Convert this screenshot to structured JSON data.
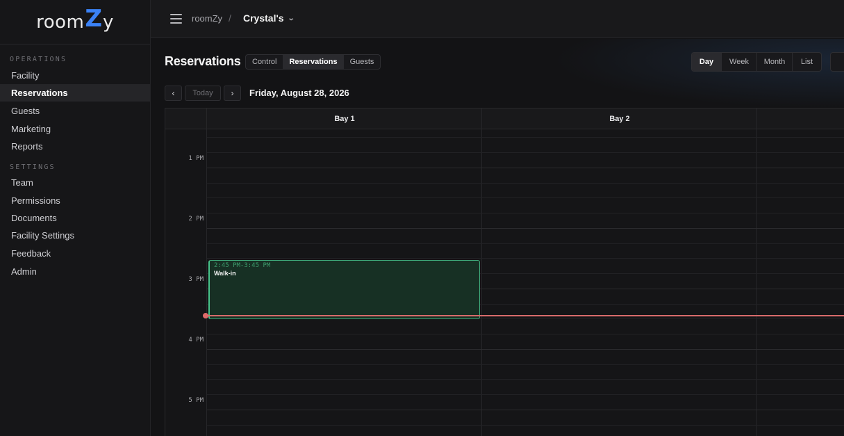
{
  "brand": {
    "prefix": "room",
    "mark": "Z",
    "suffix": "y"
  },
  "sidebar": {
    "operations_title": "OPERATIONS",
    "operations": [
      {
        "label": "Facility"
      },
      {
        "label": "Reservations",
        "active": true
      },
      {
        "label": "Guests"
      },
      {
        "label": "Marketing"
      },
      {
        "label": "Reports"
      }
    ],
    "settings_title": "SETTINGS",
    "settings": [
      {
        "label": "Team"
      },
      {
        "label": "Permissions"
      },
      {
        "label": "Documents"
      },
      {
        "label": "Facility Settings"
      },
      {
        "label": "Feedback"
      },
      {
        "label": "Admin"
      }
    ]
  },
  "topbar": {
    "app_name": "roomZy",
    "separator": "/",
    "current_facility": "Crystal's"
  },
  "page": {
    "title": "Reservations",
    "tabs": [
      "Control",
      "Reservations",
      "Guests"
    ],
    "active_tab": "Reservations",
    "views": [
      "Day",
      "Week",
      "Month",
      "List"
    ],
    "active_view": "Day"
  },
  "date_nav": {
    "prev": "‹",
    "today": "Today",
    "next": "›",
    "date": "Friday, August 28, 2026"
  },
  "calendar": {
    "columns": [
      "Bay 1",
      "Bay 2"
    ],
    "hours": [
      "1 PM",
      "2 PM",
      "3 PM",
      "4 PM",
      "5 PM"
    ],
    "events": [
      {
        "bay": "Bay 1",
        "time": "2:45 PM-3:45 PM",
        "title": "Walk-in"
      }
    ]
  },
  "colors": {
    "accent": "#3b82f6",
    "event_border": "#47c48a",
    "event_fill": "#173024",
    "now_line": "#d96b6b"
  }
}
